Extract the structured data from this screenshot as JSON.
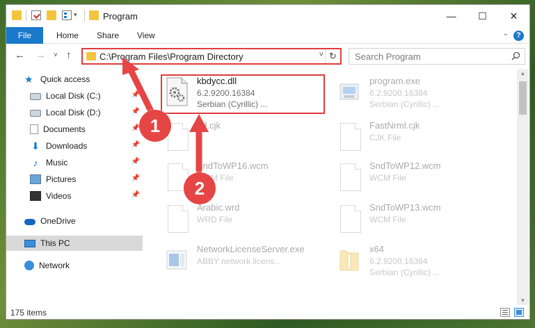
{
  "titlebar": {
    "title": "Program",
    "minimize_label": "—",
    "maximize_label": "☐",
    "close_label": "✕"
  },
  "ribbon": {
    "tabs": [
      "File",
      "Home",
      "Share",
      "View"
    ],
    "help_label": "?"
  },
  "navigation": {
    "back_label": "←",
    "forward_label": "→",
    "recent_label": "˅",
    "up_label": "↑",
    "address": "C:\\Program Files\\Program Directory",
    "dropdown_label": "˅",
    "refresh_label": "↻",
    "search_placeholder": "Search Program"
  },
  "sidebar": {
    "items": [
      {
        "label": "Quick access",
        "icon": "star-icon"
      },
      {
        "label": "Local Disk (C:)",
        "icon": "drive-icon",
        "pinned": true
      },
      {
        "label": "Local Disk (D:)",
        "icon": "drive-icon",
        "pinned": true
      },
      {
        "label": "Documents",
        "icon": "documents-icon",
        "pinned": true
      },
      {
        "label": "Downloads",
        "icon": "download-icon",
        "pinned": true
      },
      {
        "label": "Music",
        "icon": "music-icon",
        "pinned": true
      },
      {
        "label": "Pictures",
        "icon": "pictures-icon",
        "pinned": true
      },
      {
        "label": "Videos",
        "icon": "videos-icon",
        "pinned": true
      },
      {
        "label": "OneDrive",
        "icon": "cloud-icon"
      },
      {
        "label": "This PC",
        "icon": "computer-icon",
        "selected": true
      },
      {
        "label": "Network",
        "icon": "network-icon"
      }
    ],
    "pin_glyph": "📌"
  },
  "files": [
    {
      "name": "kbdycc.dll",
      "line2": "6.2.9200.16384",
      "line3": "Serbian (Cyrillic) ...",
      "icon": "dll-gear-icon",
      "highlighted": true
    },
    {
      "name": "program.exe",
      "line2": "6.2.9200.16384",
      "line3": "Serbian (Cyrillic) ...",
      "icon": "exe-icon"
    },
    {
      "name": "ttd.cjk",
      "line2": "",
      "line3": "",
      "icon": "file-icon"
    },
    {
      "name": "FastNrml.cjk",
      "line2": "CJK File",
      "line3": "",
      "icon": "file-icon"
    },
    {
      "name": "SndToWP16.wcm",
      "line2": "WCM File",
      "line3": "",
      "icon": "file-icon"
    },
    {
      "name": "SndToWP12.wcm",
      "line2": "WCM File",
      "line3": "",
      "icon": "file-icon"
    },
    {
      "name": "Arabic.wrd",
      "line2": "WRD File",
      "line3": "",
      "icon": "file-icon"
    },
    {
      "name": "SndToWP13.wcm",
      "line2": "WCM File",
      "line3": "",
      "icon": "file-icon"
    },
    {
      "name": "NetworkLicenseServer.exe",
      "line2": "ABBY network licens...",
      "line3": "",
      "icon": "app-icon"
    },
    {
      "name": "x64",
      "line2": "6.2.9200.16384",
      "line3": "Serbian (Cyrillic) ...",
      "icon": "zip-folder-icon"
    }
  ],
  "status": {
    "item_count": "175 items"
  },
  "annotations": {
    "step1": "1",
    "step2": "2",
    "color": "#e64545"
  }
}
